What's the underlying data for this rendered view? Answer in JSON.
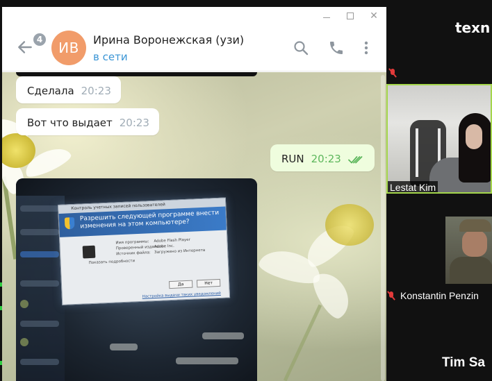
{
  "meeting": {
    "title_fragment": "texn",
    "participants": [
      {
        "name": "Lestat Kim"
      },
      {
        "name": "Konstantin Penzin"
      },
      {
        "name": "Tim Sa"
      }
    ]
  },
  "telegram": {
    "window_controls": {
      "minimize": "—",
      "maximize": "□",
      "close": "✕"
    },
    "header": {
      "unread_count": "4",
      "avatar_initials": "ИВ",
      "contact_name": "Ирина Воронежская (узи)",
      "status": "в сети",
      "icons": [
        "back-arrow-icon",
        "search-icon",
        "phone-icon",
        "more-vertical-icon"
      ]
    },
    "messages": [
      {
        "direction": "in",
        "text": "Сделала",
        "time": "20:23"
      },
      {
        "direction": "in",
        "text": "Вот что выдает",
        "time": "20:23"
      },
      {
        "direction": "out",
        "text": "RUN",
        "time": "20:23",
        "read": true
      }
    ],
    "photo": {
      "uac_title": "Контроль учетных записей пользователей",
      "uac_question": "Разрешить следующей программе внести изменения на этом компьютере?",
      "uac_fields": [
        {
          "label": "Имя программы:",
          "value": "Adobe Flash Player"
        },
        {
          "label": "Проверенный издатель:",
          "value": "Adobe Inc."
        },
        {
          "label": "Источник файла:",
          "value": "Загружено из Интернета"
        }
      ],
      "uac_details": "Показать подробности",
      "uac_yes": "Да",
      "uac_no": "Нет",
      "uac_link": "Настройка выдачи таких уведомлений"
    },
    "colors": {
      "accent": "#3a95d5",
      "avatar": "#f19c6a",
      "outgoing_bubble": "#effdde",
      "read_check": "#5db75c"
    }
  }
}
